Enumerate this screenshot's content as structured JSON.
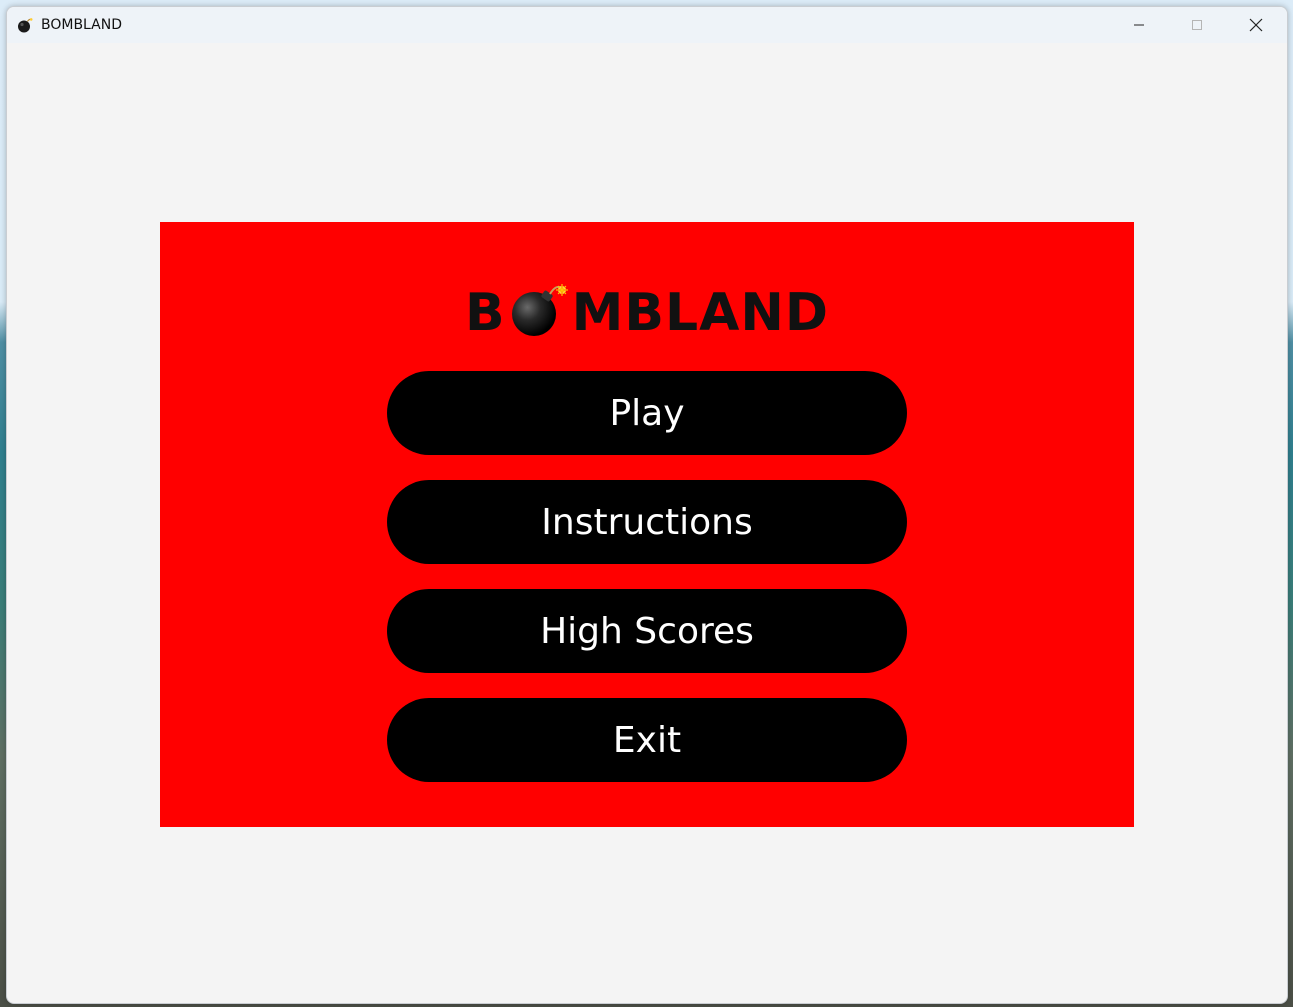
{
  "window": {
    "title": "BOMBLAND",
    "controls": [
      "minimize-icon",
      "maximize-icon",
      "close-icon"
    ]
  },
  "menu": {
    "logo_prefix": "B",
    "logo_suffix": "MBLAND",
    "logo_icon": "bomb-icon",
    "buttons": [
      {
        "label": "Play"
      },
      {
        "label": "Instructions"
      },
      {
        "label": "High Scores"
      },
      {
        "label": "Exit"
      }
    ]
  },
  "colors": {
    "panel": "#ff0000",
    "button": "#000000",
    "button_text": "#ffffff",
    "window_bg": "#f4f4f4"
  }
}
